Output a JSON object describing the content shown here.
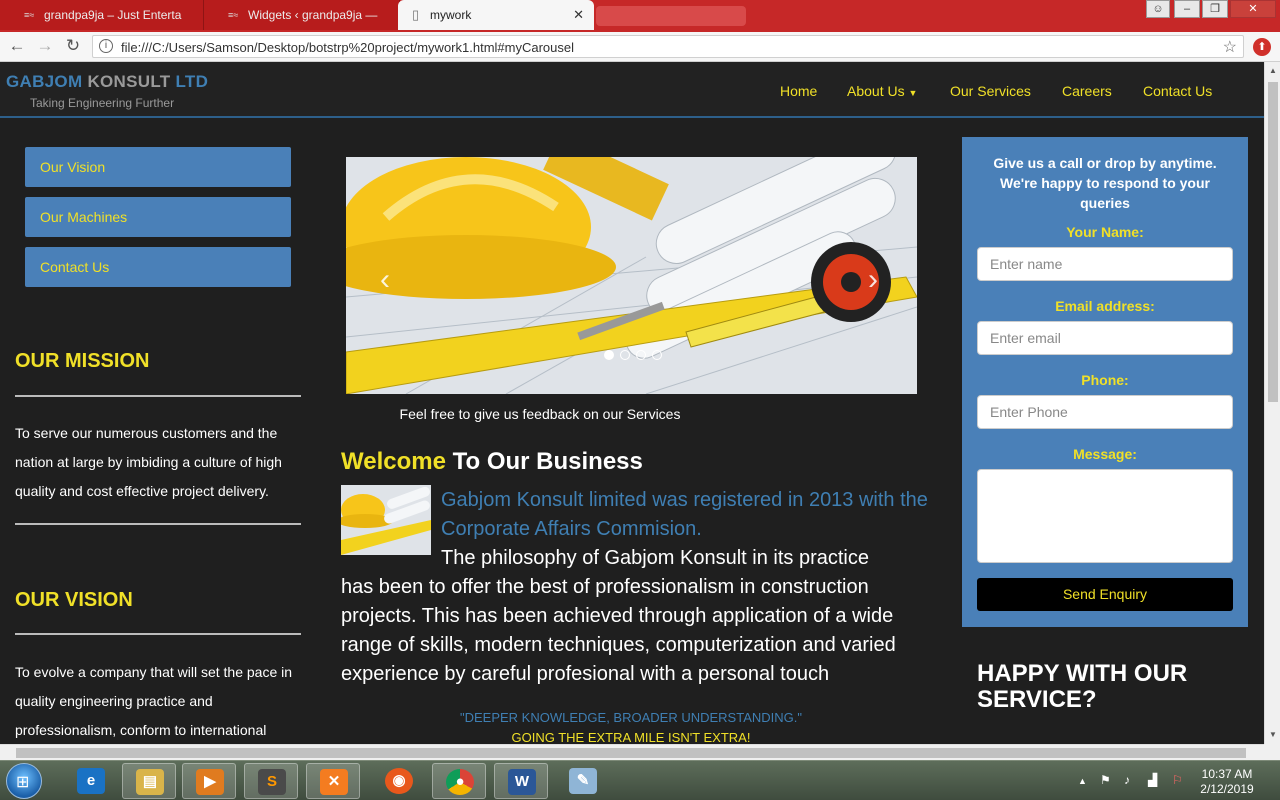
{
  "browser": {
    "tabs": [
      {
        "title": "grandpa9ja – Just Enterta",
        "favicon": "grandpa9ja-favicon-icon"
      },
      {
        "title": "Widgets ‹ grandpa9ja —",
        "favicon": "wordpress-favicon-icon"
      },
      {
        "title": "mywork",
        "favicon": "page-icon"
      }
    ],
    "new_tab_label": "",
    "url": "file:///C:/Users/Samson/Desktop/botstrp%20project/mywork1.html#myCarousel"
  },
  "site": {
    "brand": {
      "part1": "GABJOM",
      "part2": "KONSULT",
      "part3": "LTD"
    },
    "tagline": "Taking Engineering Further",
    "nav": {
      "home": "Home",
      "about": "About Us",
      "services": "Our Services",
      "careers": "Careers",
      "contact": "Contact Us"
    },
    "sidebar_buttons": [
      "Our Vision",
      "Our Machines",
      "Contact Us"
    ],
    "mission": {
      "title": "OUR MISSION",
      "text": "To serve our numerous customers and the nation at large by imbiding a culture of high quality and cost effective project delivery."
    },
    "vision": {
      "title": "OUR VISION",
      "text": "To evolve a company that will set the pace in quality engineering practice and professionalism, conform to international"
    },
    "carousel": {
      "caption": "Feel free to give us feedback on our Services",
      "slide_count": 4,
      "active_slide": 1
    },
    "welcome": {
      "highlight": "Welcome",
      "rest": "To Our Business"
    },
    "intro_blue": "Gabjom Konsult limited was registered in 2013 with the Corporate Affairs Commision.",
    "philosophy_first": "The philosophy of Gabjom Konsult in its practice",
    "philosophy_rest": "has been to offer the best of professionalism in construction projects. This has been achieved through application of a wide range of skills, modern techniques, computerization and varied experience by careful profesional with a personal touch",
    "quote1": "\"DEEPER KNOWLEDGE, BROADER UNDERSTANDING.\"",
    "quote2": "GOING THE EXTRA MILE ISN'T EXTRA!",
    "enquiry": {
      "intro": "Give us a call or drop by anytime. We're happy to respond to your queries",
      "name_label": "Your Name:",
      "name_placeholder": "Enter name",
      "email_label": "Email address:",
      "email_placeholder": "Enter email",
      "phone_label": "Phone:",
      "phone_placeholder": "Enter Phone",
      "message_label": "Message:",
      "send_label": "Send Enquiry"
    },
    "happy_title": "HAPPY WITH OUR SERVICE?"
  },
  "taskbar": {
    "apps": [
      "internet-explorer-icon",
      "file-explorer-icon",
      "media-player-icon",
      "sublime-text-icon",
      "xampp-icon",
      "firefox-icon",
      "chrome-icon",
      "word-icon",
      "paint-icon"
    ],
    "clock_time": "10:37 AM",
    "clock_date": "2/12/2019"
  },
  "colors": {
    "accent_yellow": "#f0e028",
    "brand_blue": "#4a80b8",
    "tab_red": "#c62828"
  }
}
